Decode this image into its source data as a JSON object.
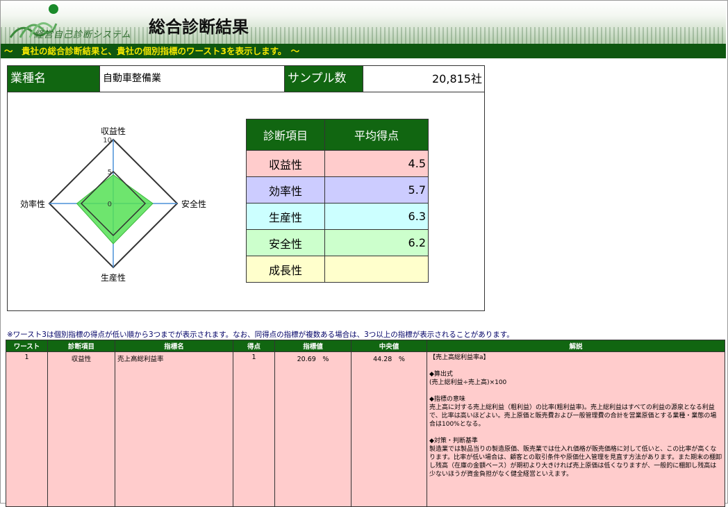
{
  "header": {
    "logo_text": "経営自己診断システム",
    "title": "総合診断結果",
    "banner": "～　貴社の総合診断結果と、貴社の個別指標のワースト3を表示します。　～"
  },
  "summary": {
    "industry_label": "業種名",
    "industry_value": "自動車整備業",
    "sample_label": "サンプル数",
    "sample_value": "20,815社"
  },
  "radar": {
    "axes": [
      "収益性",
      "安全性",
      "生産性",
      "効率性"
    ],
    "scale_ticks": [
      "10",
      "5",
      "0"
    ],
    "max": 10,
    "values": {
      "収益性": 4.5,
      "安全性": 6.2,
      "生産性": 6.3,
      "効率性": 5.7
    },
    "colors": {
      "fill": "#55e055",
      "outline": "#333333",
      "axis": "#4a90d9"
    }
  },
  "score_table": {
    "headers": [
      "診断項目",
      "平均得点"
    ],
    "rows": [
      {
        "item": "収益性",
        "score": "4.5",
        "color": "#ffcccc"
      },
      {
        "item": "効率性",
        "score": "5.7",
        "color": "#ccccff"
      },
      {
        "item": "生産性",
        "score": "6.3",
        "color": "#ccffff"
      },
      {
        "item": "安全性",
        "score": "6.2",
        "color": "#ccffcc"
      },
      {
        "item": "成長性",
        "score": "",
        "color": "#ffffcc"
      }
    ]
  },
  "note": "※ワースト3は個別指標の得点が低い順から3つまでが表示されます。なお、同得点の指標が複数ある場合は、3つ以上の指標が表示されることがあります。",
  "worst_table": {
    "headers": [
      "ワースト",
      "診断項目",
      "指標名",
      "得点",
      "指標値",
      "中央値",
      "解説"
    ],
    "rows": [
      {
        "rank": "1",
        "category": "収益性",
        "indicator": "売上高総利益率",
        "score": "1",
        "value": "20.69　%",
        "median": "44.28　%",
        "explanation": [
          "【売上高総利益率a】",
          "",
          "◆算出式",
          "(売上総利益÷売上高)×100",
          "",
          "◆指標の意味",
          "売上高に対する売上総利益（粗利益）の比率(粗利益率)。売上総利益はすべての利益の源泉となる利益で、比率は高いほどよい。売上原価と販売費および一般管理費の合計を営業原価とする業種・業態の場合は100%となる。",
          "",
          "◆対策・判断基準",
          "製造業では製品当りの製造原価、販売業では仕入れ価格が販売価格に対して低いと、この比率が高くなります。比率が低い場合は、顧客との取引条件や原価仕入管理を見直す方法があります。また期末の棚卸し残高（在庫の金額ベース）が期初より大きければ売上原価は低くなりますが、一般的に棚卸し残高は少ないほうが資金負担がなく健全経営といえます。"
        ]
      }
    ]
  }
}
